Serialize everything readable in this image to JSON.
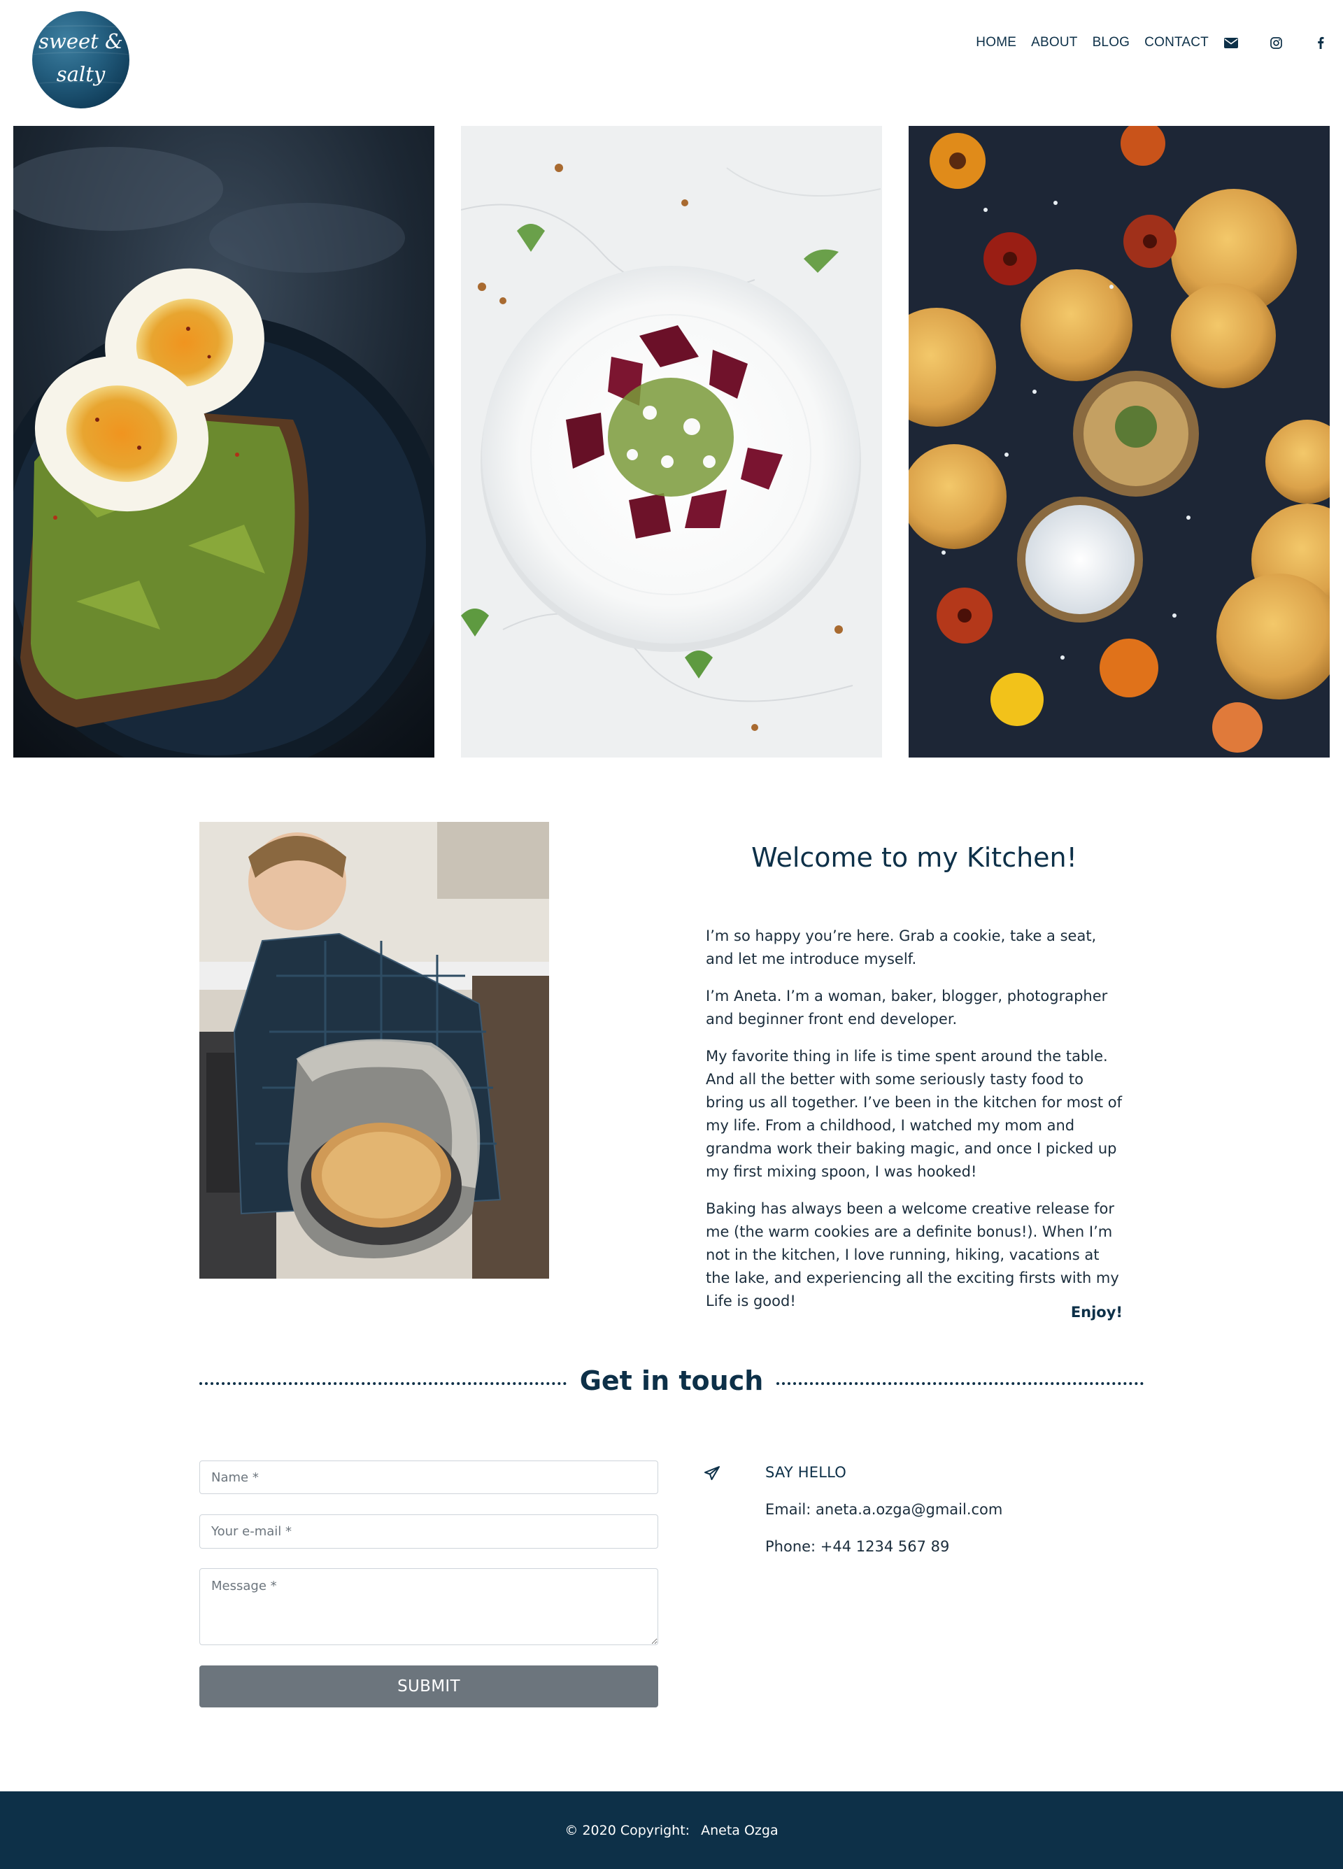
{
  "brand": {
    "logo_line1": "sweet &",
    "logo_line2": "salty",
    "colors": {
      "primary": "#0d3048",
      "button": "#6c757d",
      "footer": "#0d3048"
    }
  },
  "nav": {
    "items": [
      {
        "label": "HOME"
      },
      {
        "label": "ABOUT"
      },
      {
        "label": "BLOG"
      },
      {
        "label": "CONTACT"
      }
    ],
    "icons": [
      "envelope-icon",
      "instagram-icon",
      "facebook-icon"
    ]
  },
  "hero": {
    "images": [
      "egg-avocado-toast-photo",
      "beetroot-salad-photo",
      "scones-flowers-photo"
    ]
  },
  "about": {
    "photo": "baker-holding-cake-photo",
    "title": "Welcome to my Kitchen!",
    "paragraphs": [
      "I’m so happy you’re here. Grab a cookie, take a seat, and let me introduce myself.",
      "I’m Aneta. I’m a woman, baker, blogger, photographer and beginner front end developer.",
      "My favorite thing in life is time spent around the table. And all the better with some seriously tasty food to bring us all together. I’ve been in the kitchen for most of my life. From a childhood, I watched my mom and grandma work their baking magic, and once I picked up my first mixing spoon, I was hooked!",
      "Baking has always been a welcome creative release for me (the warm cookies are a definite bonus!). When I’m not in the kitchen, I love running, hiking, vacations at the lake, and experiencing all the exciting firsts with my Life is good!"
    ],
    "signoff": "Enjoy!"
  },
  "contact": {
    "title": "Get in touch",
    "form": {
      "name_placeholder": "Name *",
      "email_placeholder": "Your e-mail *",
      "message_placeholder": "Message *",
      "submit_label": "SUBMIT"
    },
    "heading": "SAY HELLO",
    "email_line": "Email: aneta.a.ozga@gmail.com",
    "phone_line": "Phone: +44 1234 567 89"
  },
  "footer": {
    "copyright": "© 2020 Copyright:",
    "author": "Aneta Ozga"
  }
}
